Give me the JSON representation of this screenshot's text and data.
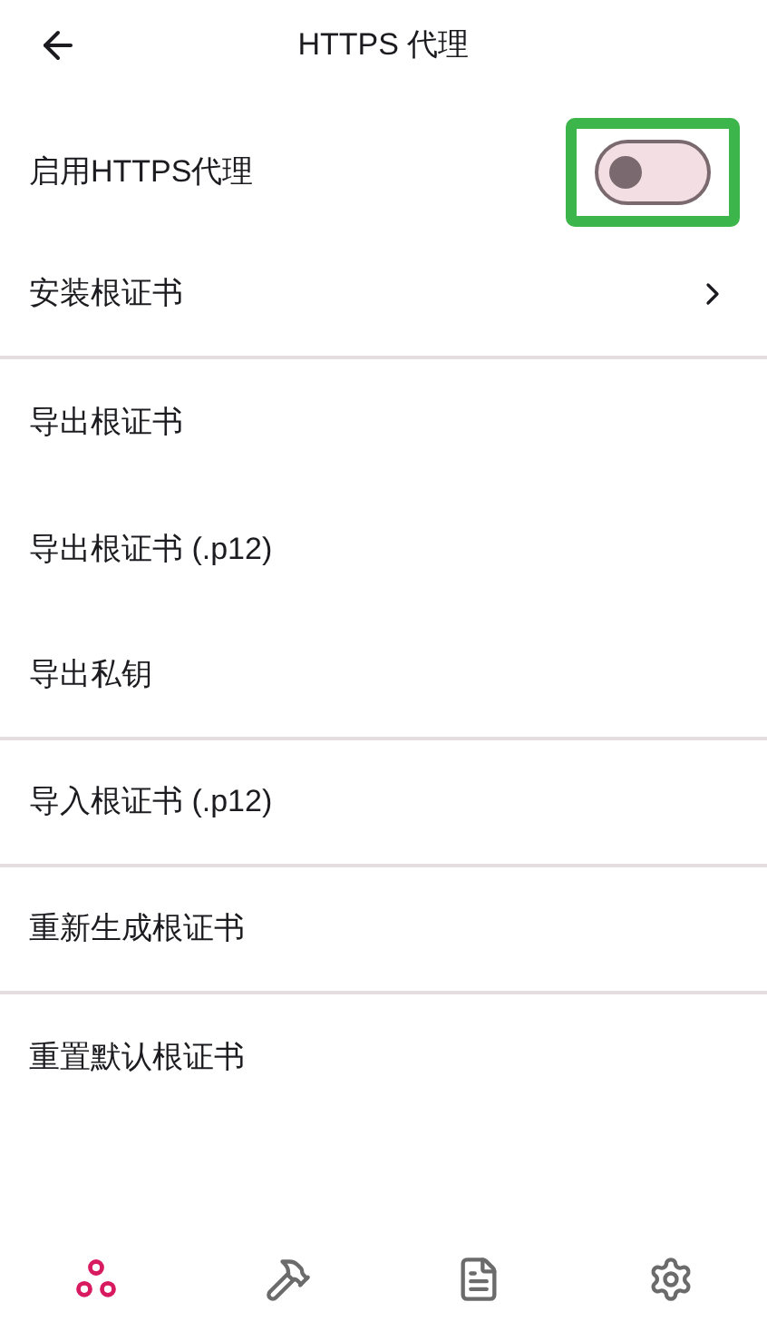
{
  "header": {
    "title": "HTTPS 代理"
  },
  "settings": [
    {
      "kind": "toggle",
      "label": "启用HTTPS代理",
      "on": false,
      "highlighted": true,
      "divider_after": false
    },
    {
      "kind": "link",
      "label": "安装根证书",
      "divider_after": true
    },
    {
      "kind": "action",
      "label": "导出根证书",
      "divider_after": false
    },
    {
      "kind": "action",
      "label": "导出根证书 (.p12)",
      "divider_after": false
    },
    {
      "kind": "action",
      "label": "导出私钥",
      "divider_after": true
    },
    {
      "kind": "action",
      "label": "导入根证书 (.p12)",
      "divider_after": true
    },
    {
      "kind": "action",
      "label": "重新生成根证书",
      "divider_after": true
    },
    {
      "kind": "action",
      "label": "重置默认根证书",
      "divider_after": false
    }
  ],
  "bottom_nav": [
    {
      "kind": "nodes",
      "selected": true
    },
    {
      "kind": "tools",
      "selected": false
    },
    {
      "kind": "document",
      "selected": false
    },
    {
      "kind": "settings",
      "selected": false
    }
  ]
}
